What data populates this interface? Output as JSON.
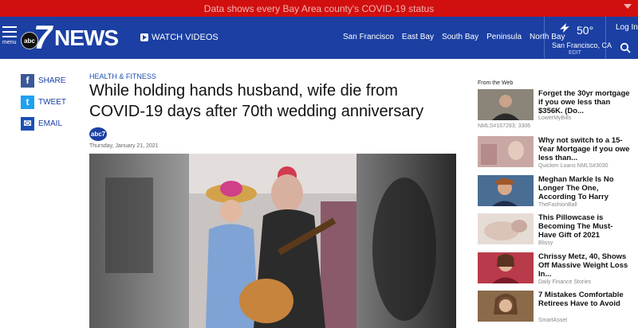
{
  "alert": {
    "text": "Data shows every Bay Area county's COVID-19 status"
  },
  "header": {
    "menu_label": "menu",
    "logo_abc": "abc",
    "logo_seven": "7",
    "logo_news": "NEWS",
    "watch_label": "WATCH VIDEOS",
    "nav": [
      "San Francisco",
      "East Bay",
      "South Bay",
      "Peninsula",
      "North Bay"
    ],
    "weather": {
      "temp": "50°",
      "location": "San Francisco, CA",
      "edit": "EDIT"
    },
    "login_label": "Log In"
  },
  "share": [
    {
      "label": "SHARE",
      "icon": "facebook-icon",
      "glyph": "f",
      "color": "#3b5998"
    },
    {
      "label": "TWEET",
      "icon": "twitter-icon",
      "glyph": "t",
      "color": "#1da1f2"
    },
    {
      "label": "EMAIL",
      "icon": "email-icon",
      "glyph": "✉",
      "color": "#1b4fb3"
    }
  ],
  "article": {
    "kicker": "HEALTH & FITNESS",
    "headline": "While holding hands husband, wife die from COVID-19 days after 70th wedding anniversary",
    "byline_logo": "abc7",
    "date": "Thursday, January 21, 2021"
  },
  "sidebar": {
    "heading": "From the Web",
    "items": [
      {
        "title": "Forget the 30yr mortgage if you owe less than $356K. (Do...",
        "source": "LowerMyBills",
        "extra": "NMLS#167283; 3306"
      },
      {
        "title": "Why not switch to a 15-Year Mortgage if you owe less than...",
        "source": "Quicken Loans NMLS#3030"
      },
      {
        "title": "Meghan Markle Is No Longer The One, According To Harry",
        "source": "TheFashionBall"
      },
      {
        "title": "This Pillowcase is Becoming The Must-Have Gift of 2021",
        "source": "Blissy"
      },
      {
        "title": "Chrissy Metz, 40, Shows Off Massive Weight Loss In...",
        "source": "Daily Finance Stories"
      },
      {
        "title": "7 Mistakes Comfortable Retirees Have to Avoid",
        "source": "SmartAsset"
      }
    ]
  },
  "colors": {
    "alert_bg": "#d10f0f",
    "header_bg": "#1b3fa3",
    "kicker": "#1b4fb3"
  }
}
